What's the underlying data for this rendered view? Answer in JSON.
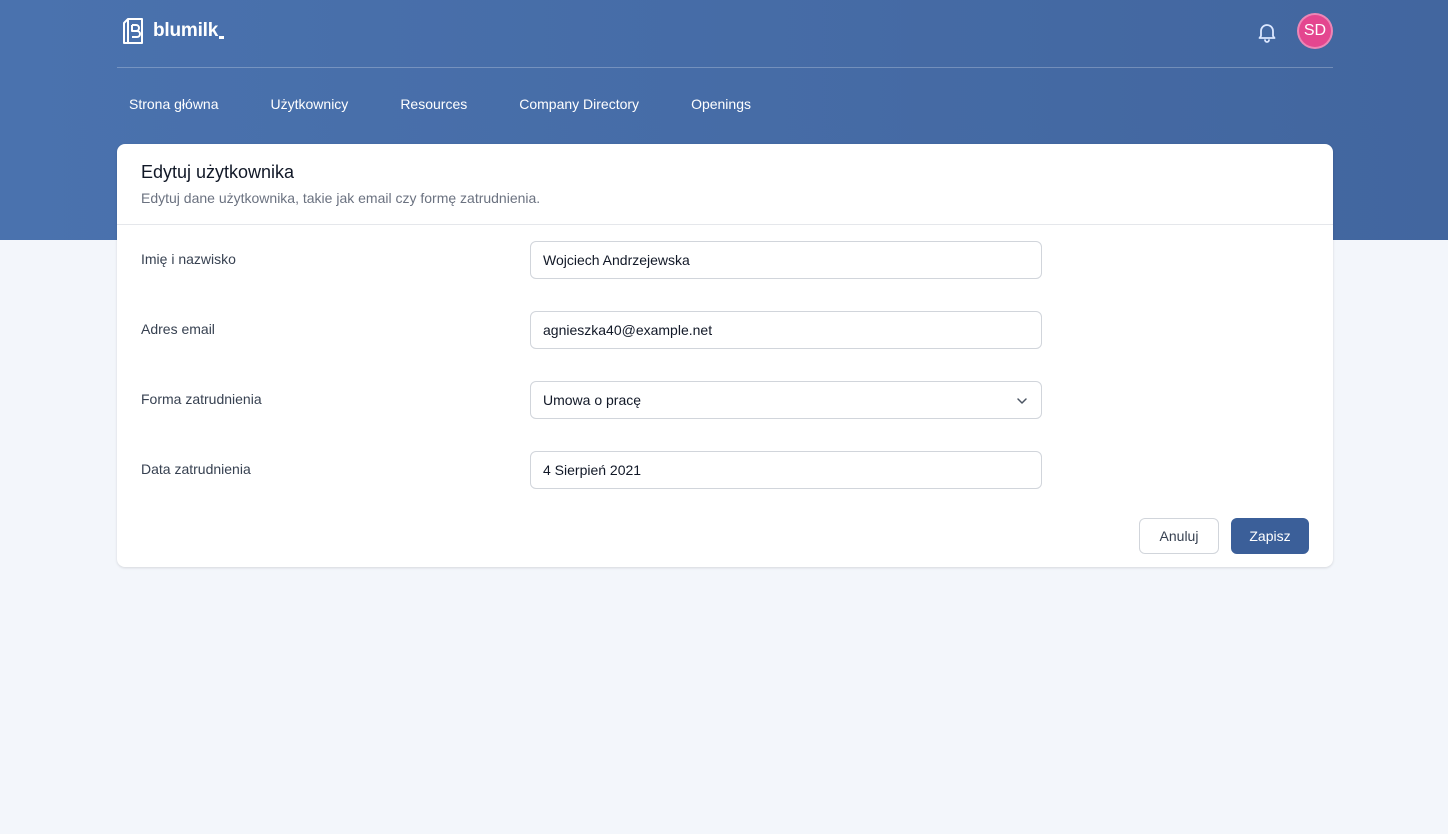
{
  "brand": {
    "name": "blumilk",
    "accent": "#4a72ae"
  },
  "header": {
    "notifications_icon": "bell-icon",
    "avatar_initials": "SD",
    "avatar_color": "#e4468f"
  },
  "nav": {
    "items": [
      {
        "label": "Strona główna"
      },
      {
        "label": "Użytkownicy"
      },
      {
        "label": "Resources"
      },
      {
        "label": "Company Directory"
      },
      {
        "label": "Openings"
      }
    ]
  },
  "form": {
    "title": "Edytuj użytkownika",
    "subtitle": "Edytuj dane użytkownika, takie jak email czy formę zatrudnienia.",
    "fields": {
      "name": {
        "label": "Imię i nazwisko",
        "value": "Wojciech Andrzejewska"
      },
      "email": {
        "label": "Adres email",
        "value": "agnieszka40@example.net"
      },
      "employment_form": {
        "label": "Forma zatrudnienia",
        "value": "Umowa o pracę"
      },
      "employment_date": {
        "label": "Data zatrudnienia",
        "value": "4 Sierpień 2021"
      }
    },
    "actions": {
      "cancel_label": "Anuluj",
      "save_label": "Zapisz"
    }
  }
}
